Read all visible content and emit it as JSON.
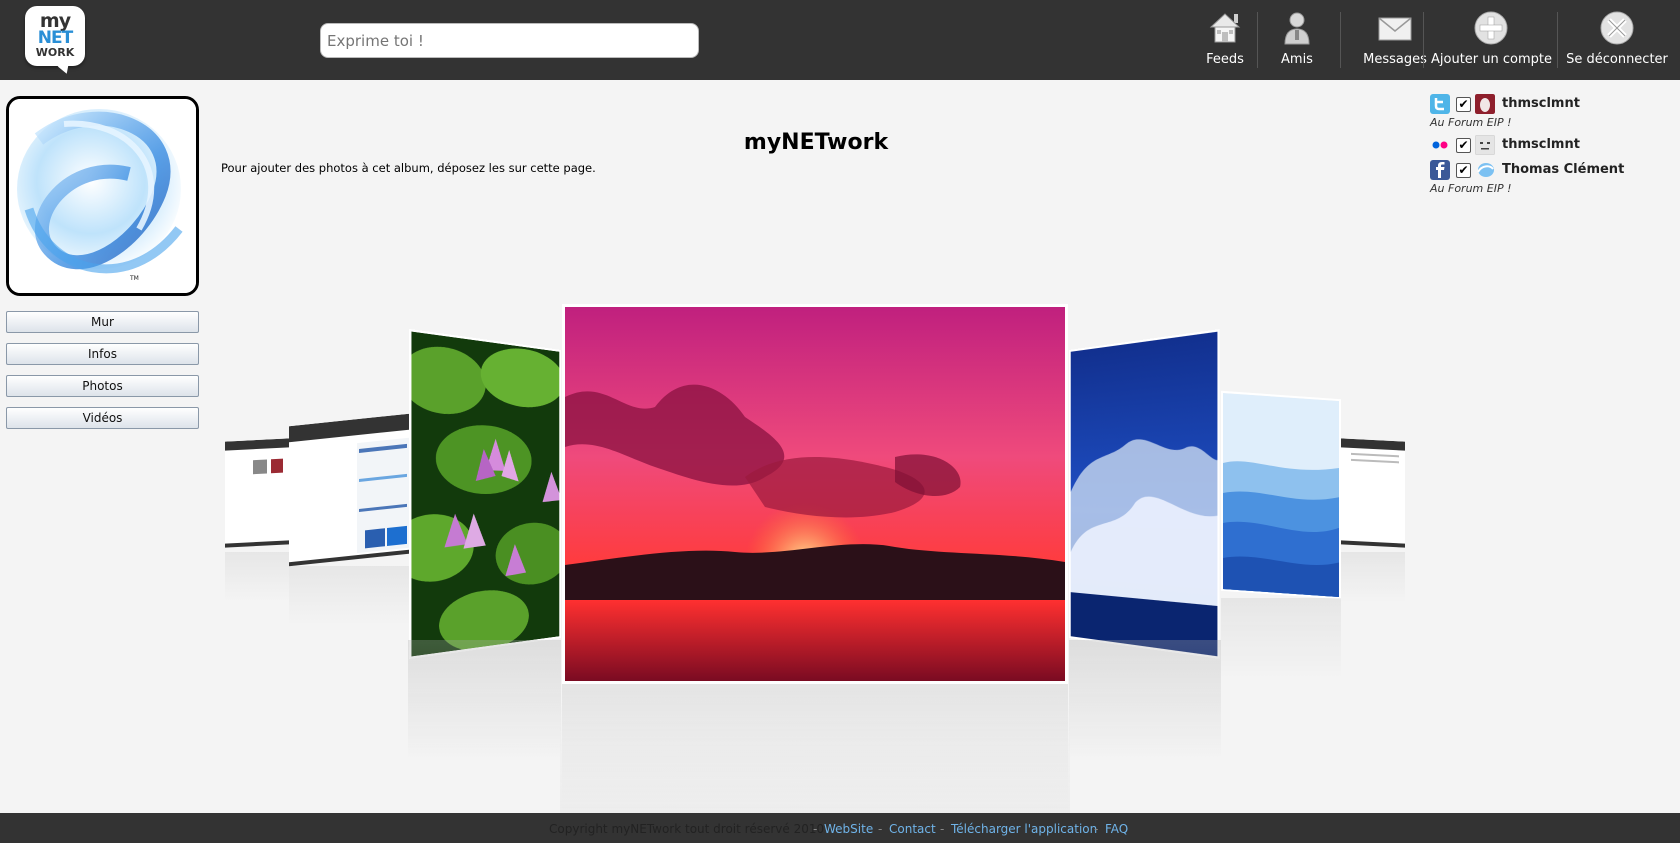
{
  "app": {
    "logo": {
      "line1": "my",
      "line2": "NET",
      "line3": "WORK"
    },
    "status_placeholder": "Exprime toi !"
  },
  "nav": [
    {
      "label": "Feeds",
      "icon": "home-icon"
    },
    {
      "label": "Amis",
      "icon": "user-icon"
    },
    {
      "label": "Messages",
      "icon": "envelope-icon"
    },
    {
      "label": "Ajouter un compte",
      "icon": "plus-circle-icon"
    },
    {
      "label": "Se déconnecter",
      "icon": "close-circle-icon"
    }
  ],
  "sidebar": {
    "avatar_tm": "TM",
    "menu": [
      "Mur",
      "Infos",
      "Photos",
      "Vidéos"
    ]
  },
  "main": {
    "title": "myNETwork",
    "hint": "Pour ajouter des photos à cet album, déposez les sur cette page."
  },
  "accounts": [
    {
      "network": "twitter",
      "name": "thmsclmnt",
      "status": "Au Forum EIP !",
      "checked": "✔"
    },
    {
      "network": "flickr",
      "name": "thmsclmnt",
      "status": "",
      "checked": "✔"
    },
    {
      "network": "facebook",
      "name": "Thomas Clément",
      "status": "Au Forum EIP !",
      "checked": "✔"
    }
  ],
  "footer": {
    "copyright": "Copyright myNETwork tout droit réservé 2010",
    "links": [
      "WebSite",
      "Contact",
      "Télécharger l'application",
      "FAQ"
    ],
    "separator": "-"
  },
  "colors": {
    "topbar": "#333333",
    "background": "#f4f4f4",
    "link": "#6fb3e8",
    "logo_blue": "#2a8fd6"
  }
}
